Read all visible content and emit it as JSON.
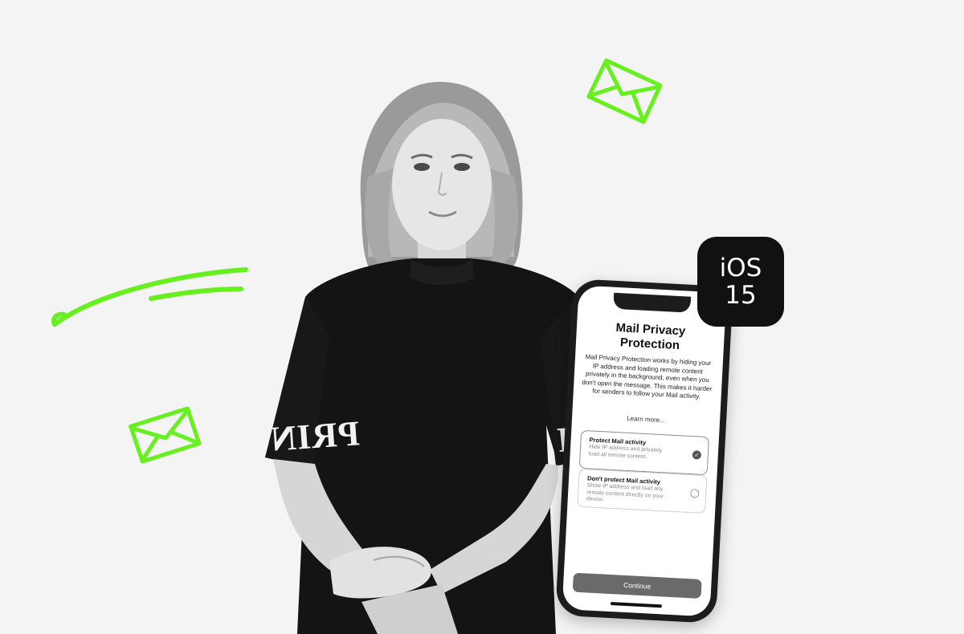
{
  "colors": {
    "background": "#f4f4f4",
    "accent_green": "#66f01e",
    "badge": "#111111"
  },
  "decorations": {
    "top_envelope_icon": "envelope-icon",
    "left_envelope_icon": "envelope-icon",
    "swoosh": "swoosh-lines"
  },
  "person": {
    "sleeve_left_text": "PRIN",
    "sleeve_right_text": "PR"
  },
  "badge": {
    "line1": "iOS",
    "line2": "15"
  },
  "phone_screen": {
    "title": "Mail Privacy Protection",
    "body": "Mail Privacy Protection works by hiding your IP address and loading remote content privately in the background, even when you don't open the message. This makes it harder for senders to follow your Mail activity.",
    "learn_more": "Learn more...",
    "options": [
      {
        "title": "Protect Mail activity",
        "description": "Hide IP address and privately load all remote content.",
        "selected": true
      },
      {
        "title": "Don't protect Mail activity",
        "description": "Show IP address and load any remote content directly on your device.",
        "selected": false
      }
    ],
    "continue_label": "Continue"
  }
}
